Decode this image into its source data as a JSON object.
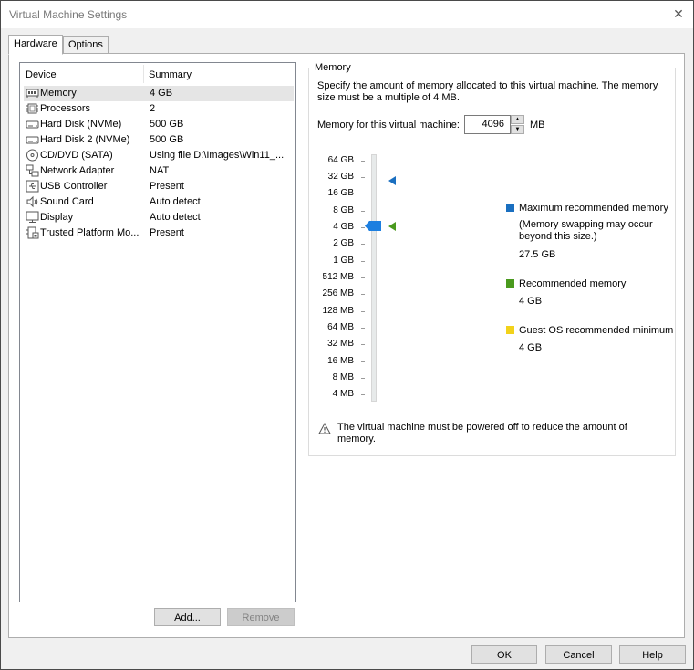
{
  "window": {
    "title": "Virtual Machine Settings",
    "close_icon": "close-icon"
  },
  "tabs": [
    {
      "label": "Hardware",
      "active": true
    },
    {
      "label": "Options",
      "active": false
    }
  ],
  "device_list": {
    "header_device": "Device",
    "header_summary": "Summary",
    "items": [
      {
        "name": "Memory",
        "summary": "4 GB",
        "icon": "memory-icon",
        "selected": true
      },
      {
        "name": "Processors",
        "summary": "2",
        "icon": "processor-icon"
      },
      {
        "name": "Hard Disk (NVMe)",
        "summary": "500 GB",
        "icon": "hard-disk-icon"
      },
      {
        "name": "Hard Disk 2 (NVMe)",
        "summary": "500 GB",
        "icon": "hard-disk-icon"
      },
      {
        "name": "CD/DVD (SATA)",
        "summary": "Using file D:\\Images\\Win11_...",
        "icon": "cd-dvd-icon"
      },
      {
        "name": "Network Adapter",
        "summary": "NAT",
        "icon": "network-adapter-icon"
      },
      {
        "name": "USB Controller",
        "summary": "Present",
        "icon": "usb-icon"
      },
      {
        "name": "Sound Card",
        "summary": "Auto detect",
        "icon": "speaker-icon"
      },
      {
        "name": "Display",
        "summary": "Auto detect",
        "icon": "monitor-icon"
      },
      {
        "name": "Trusted Platform Mo...",
        "summary": "Present",
        "icon": "tpm-icon"
      }
    ]
  },
  "buttons": {
    "add": "Add...",
    "remove": "Remove",
    "ok": "OK",
    "cancel": "Cancel",
    "help": "Help"
  },
  "memory_panel": {
    "group_label": "Memory",
    "description": "Specify the amount of memory allocated to this virtual machine. The memory size must be a multiple of 4 MB.",
    "field_label": "Memory for this virtual machine:",
    "field_value": "4096",
    "unit": "MB",
    "scale_labels": [
      "64 GB",
      "32 GB",
      "16 GB",
      "8 GB",
      "4 GB",
      "2 GB",
      "1 GB",
      "512 MB",
      "256 MB",
      "128 MB",
      "64 MB",
      "32 MB",
      "16 MB",
      "8 MB",
      "4 MB"
    ],
    "slider_value": "4 GB",
    "legend": {
      "max_label": "Maximum recommended memory",
      "max_note": "(Memory swapping may occur beyond this size.)",
      "max_value": "27.5 GB",
      "rec_label": "Recommended memory",
      "rec_value": "4 GB",
      "min_label": "Guest OS recommended minimum",
      "min_value": "4 GB"
    },
    "warning": "The virtual machine must be powered off to reduce the amount of memory."
  },
  "colors": {
    "max": "#1a6fc0",
    "recommended": "#4a9a1e",
    "minimum": "#f2d21b",
    "thumb": "#1d7fe0"
  }
}
